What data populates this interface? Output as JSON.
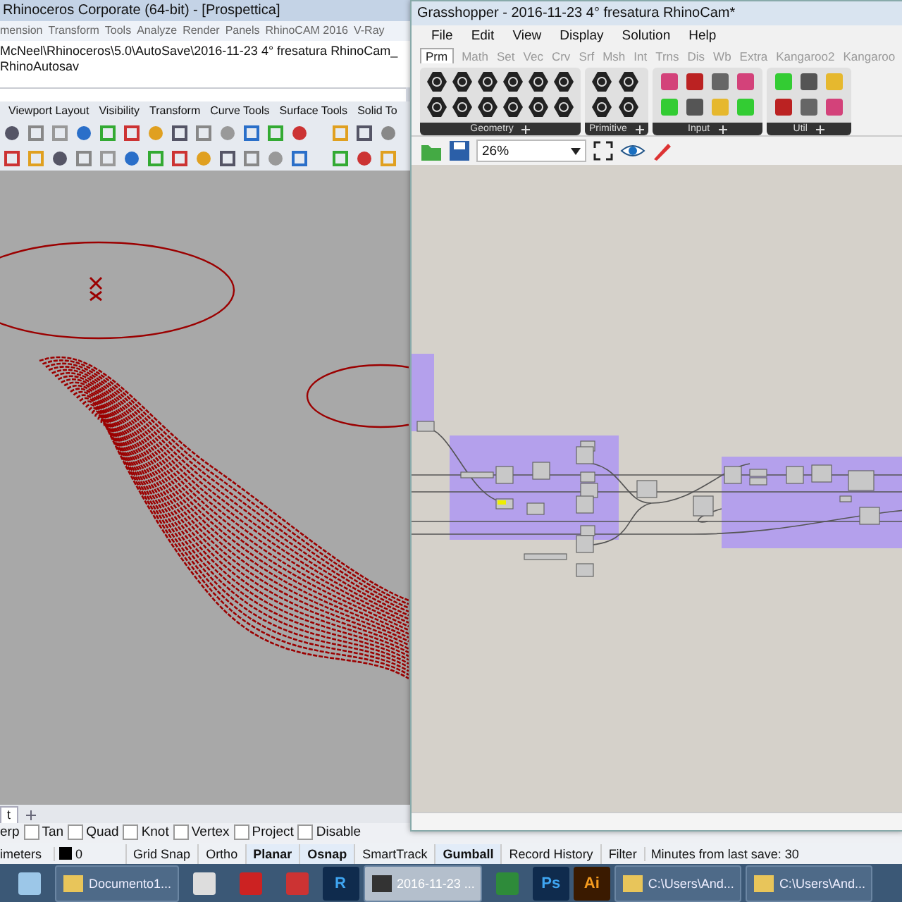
{
  "rhino": {
    "title": "Rhinoceros Corporate (64-bit) - [Prospettica]",
    "menu": [
      "mension",
      "Transform",
      "Tools",
      "Analyze",
      "Render",
      "Panels",
      "RhinoCAM 2016",
      "V-Ray"
    ],
    "command_history": "McNeel\\Rhinoceros\\5.0\\AutoSave\\2016-11-23 4° fresatura RhinoCam_RhinoAutosav",
    "toolbar_tabs": [
      "Viewport Layout",
      "Visibility",
      "Transform",
      "Curve Tools",
      "Surface Tools",
      "Solid To"
    ],
    "viewport_tabs": [
      {
        "label": "t",
        "selected": true
      }
    ],
    "osnaps": [
      {
        "label": "erp",
        "checked": false
      },
      {
        "label": "Tan",
        "checked": false
      },
      {
        "label": "Quad",
        "checked": false
      },
      {
        "label": "Knot",
        "checked": false
      },
      {
        "label": "Vertex",
        "checked": false
      },
      {
        "label": "Project",
        "checked": false
      },
      {
        "label": "Disable",
        "checked": false
      }
    ],
    "status_bar": {
      "units": "imeters",
      "layer": "0",
      "panes": [
        {
          "label": "Grid Snap",
          "on": false
        },
        {
          "label": "Ortho",
          "on": false
        },
        {
          "label": "Planar",
          "on": true
        },
        {
          "label": "Osnap",
          "on": true
        },
        {
          "label": "SmartTrack",
          "on": false
        },
        {
          "label": "Gumball",
          "on": true
        },
        {
          "label": "Record History",
          "on": false
        },
        {
          "label": "Filter",
          "on": false
        }
      ],
      "save_info": "Minutes from last save: 30"
    }
  },
  "grasshopper": {
    "title": "Grasshopper - 2016-11-23 4° fresatura RhinoCam*",
    "menu": [
      "File",
      "Edit",
      "View",
      "Display",
      "Solution",
      "Help"
    ],
    "tabs": [
      {
        "label": "Prm",
        "selected": true
      },
      {
        "label": "Math",
        "selected": false
      },
      {
        "label": "Set",
        "selected": false
      },
      {
        "label": "Vec",
        "selected": false
      },
      {
        "label": "Crv",
        "selected": false
      },
      {
        "label": "Srf",
        "selected": false
      },
      {
        "label": "Msh",
        "selected": false
      },
      {
        "label": "Int",
        "selected": false
      },
      {
        "label": "Trns",
        "selected": false
      },
      {
        "label": "Dis",
        "selected": false
      },
      {
        "label": "Wb",
        "selected": false
      },
      {
        "label": "Extra",
        "selected": false
      },
      {
        "label": "Kangaroo2",
        "selected": false
      },
      {
        "label": "Kangaroo",
        "selected": false
      }
    ],
    "panel_groups": [
      "Geometry",
      "Primitive",
      "Input",
      "Util"
    ],
    "zoom": "26%"
  },
  "taskbar": [
    {
      "kind": "icon",
      "selected": false
    },
    {
      "kind": "app",
      "label": "Documento1...",
      "selected": false
    },
    {
      "kind": "icon",
      "selected": false
    },
    {
      "kind": "icon",
      "selected": false
    },
    {
      "kind": "icon",
      "selected": false
    },
    {
      "kind": "glyph",
      "label": "R",
      "selected": false
    },
    {
      "kind": "app",
      "label": "2016-11-23 ...",
      "selected": true
    },
    {
      "kind": "icon",
      "selected": false
    },
    {
      "kind": "glyph",
      "label": "Ps",
      "selected": false
    },
    {
      "kind": "glyph",
      "label": "Ai",
      "selected": false
    },
    {
      "kind": "app",
      "label": "C:\\Users\\And...",
      "selected": false
    },
    {
      "kind": "app",
      "label": "C:\\Users\\And...",
      "selected": false
    }
  ]
}
